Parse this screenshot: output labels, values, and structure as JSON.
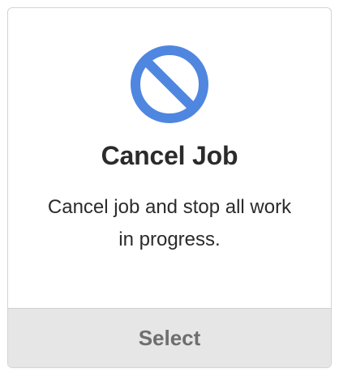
{
  "card": {
    "icon": "prohibited-icon",
    "icon_color": "#4f86e0",
    "title": "Cancel Job",
    "description": "Cancel job and stop all work in progress.",
    "select_label": "Select"
  }
}
